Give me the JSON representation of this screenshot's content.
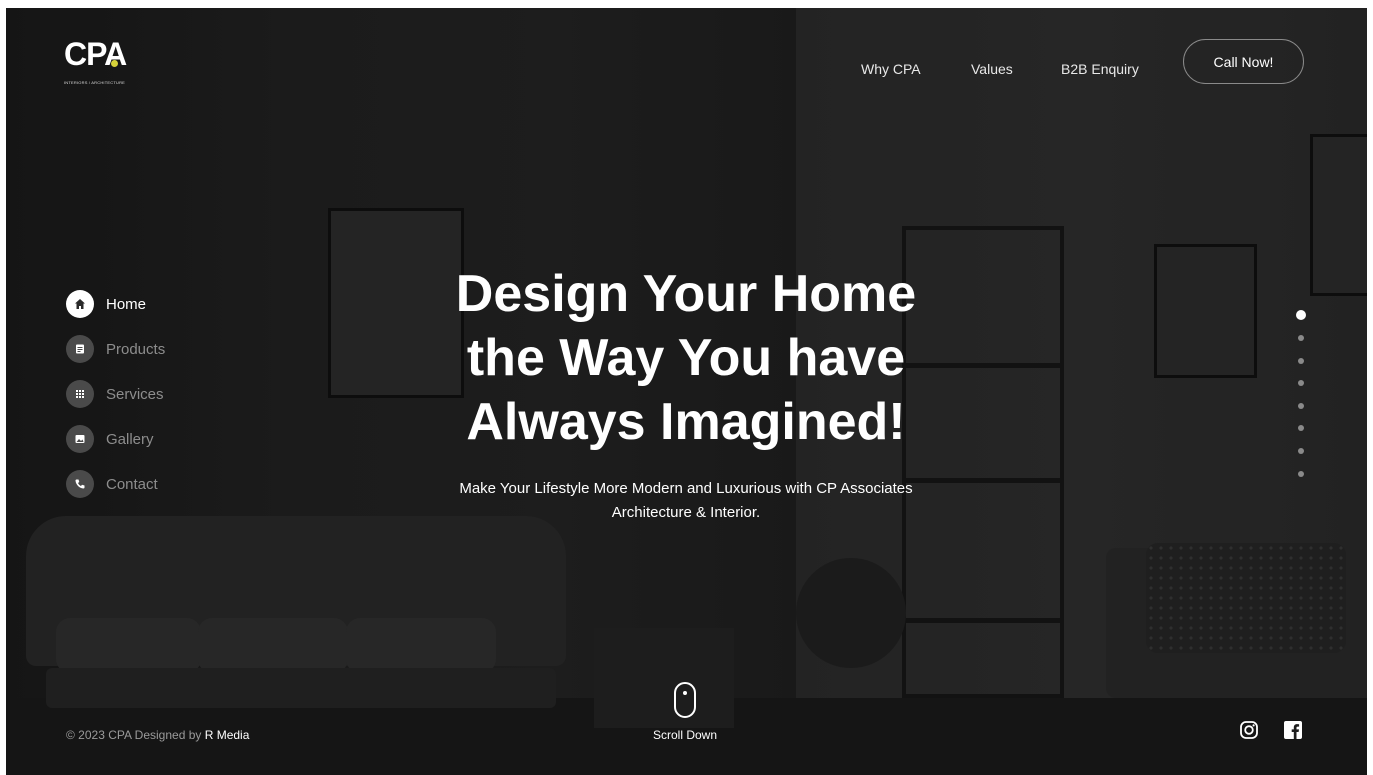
{
  "brand": {
    "logo_text": "CPA",
    "logo_subtitle": "INTERIORS / ARCHITECTURE",
    "accent_dot_color": "#d6d23a"
  },
  "header": {
    "nav": [
      {
        "label": "Why CPA"
      },
      {
        "label": "Values"
      },
      {
        "label": "B2B Enquiry"
      }
    ],
    "cta_label": "Call Now!"
  },
  "sidebar": {
    "items": [
      {
        "label": "Home",
        "icon": "home-icon",
        "active": true
      },
      {
        "label": "Products",
        "icon": "document-icon",
        "active": false
      },
      {
        "label": "Services",
        "icon": "grid-icon",
        "active": false
      },
      {
        "label": "Gallery",
        "icon": "image-icon",
        "active": false
      },
      {
        "label": "Contact",
        "icon": "phone-icon",
        "active": false
      }
    ]
  },
  "hero": {
    "title_line1": "Design Your Home",
    "title_line2": "the Way You have",
    "title_line3": "Always Imagined!",
    "subtitle_line1": "Make Your Lifestyle More Modern and Luxurious with CP Associates",
    "subtitle_line2": "Architecture & Interior."
  },
  "pager": {
    "count": 8,
    "active_index": 0
  },
  "footer": {
    "copyright_prefix": "© 2023 CPA Designed by ",
    "copyright_author": "R Media",
    "scroll_label": "Scroll Down",
    "social": [
      {
        "icon": "instagram-icon"
      },
      {
        "icon": "facebook-icon"
      }
    ]
  }
}
